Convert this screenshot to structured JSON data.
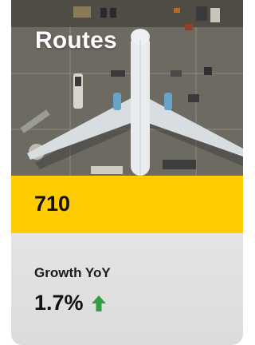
{
  "card": {
    "title": "Routes",
    "value": "710",
    "growth": {
      "label": "Growth YoY",
      "value": "1.7%",
      "trend_icon": "arrow-up-icon",
      "trend_color": "#2f9e44"
    }
  },
  "colors": {
    "accent": "#fecc00",
    "panel": "#e6e6e6",
    "text": "#111111"
  }
}
